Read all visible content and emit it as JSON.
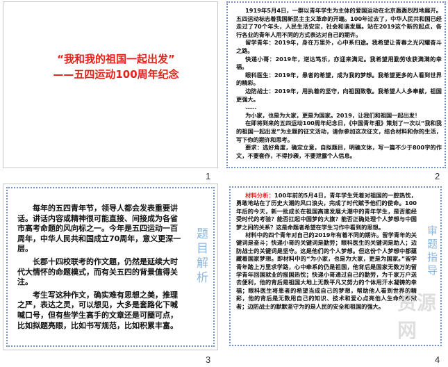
{
  "slides": [
    {
      "number": "1",
      "title_line1": "“我和我的祖国一起出发”",
      "title_line2": "——五四运动100周年纪念"
    },
    {
      "number": "2",
      "paragraphs": [
        "1919年5月4日，一群以青年学生为主体的爱国运动在北京轰轰烈烈地展开。五四运动标志着我国新民主主义革命的开端。100年过去了，中华人民共和国已经走过了70个年头，人民生活安定，社会和谐发展。站在2019这个新的起点，各行各业的青年人用不同的方式表达对自己的期许。",
        "留学青年：2019年，身在万里外，心中系归途。我希望让青春之光闪耀奋斗之路。",
        "快递小哥：2019年，逆达笃乐，亦迎来满足。我希望用勤劳收获满满的幸福。",
        "眼科医生：2019年，患者的希望，成为我的梦想。我希望更多的人看到世界的精彩。",
        "边防战士：2019年，用执着的坚守，向祖国致敬。我希望人人多奉献，祖国更强大。",
        "……",
        "为小家，也是为大家，更是为国家。2019，让我们和祖国一起出发！",
        "在即将到来的五四运动100周年纪念日，《中国青年报》策划了一次以“我和我的祖国一起出发”为主题的征文活动，请你参加这次征文，结合材料和你的生活，写下你的期许和思考。",
        "要求：选好角度，确定立意，自拟题目，明确文体，写一篇不少于800字的作文，不要套作，不得抄袭，不要泄露个人信息。"
      ]
    },
    {
      "number": "3",
      "paragraphs": [
        "每年的五四青年节，领导人都会发表重要讲话。讲话内容或精神很可能直接、间接成为各省市高考命题的风向标之一。今年是五四运动一百周年，中华人民共和国成立70周年，意义更深一层。",
        "长郡十四校联考的作文题，仍然是延续大时代大情怀的命题模式，而有关五四的背景值得关注。",
        "考生写这种作文，确实难有思想之美，推理之严，表达之灵，可以想见，大多是套路化下喊喊口号，但有些学生高手的文章还是可圈可点，比如拟题亮眼，比如书写规范，比如积累丰富。"
      ],
      "side_label": "题目解析"
    },
    {
      "number": "4",
      "lead": "材料分析",
      "paragraphs": [
        "100年前的5月4日，青年学生凭着对祖国的一腔热忱，勇敢地站在了历史大潮的风口浪尖，完成了时代赋予他们的使命。100年后的今天，新一批成长在祖国高速发展大潮中的青年学生，是否能经受时代的考验？能否扛起中国梦的大旗？能否正确处理个人梦想与中国梦之间的关系？这是命题者希望在学生习作中看到的思想。",
        "材料中的四个青年对自己的2019年有着不同的期许。留学青年的关键词是奋斗；快递小哥的关键词是勤劳；眼科医生的关键词是助人；边防战士的关键词是坚守。这是他们的个人梦想。但这份个人梦想中都蕴藏着国家梦想。即材料中的“为小家，也是为大家，更是为国家。”留学青年踏上万里求学路，心中牵系的仍是祖国，他背后是国家无数万的留学青年回国就业的报国热忱；快递小哥通过自己的勤劳，为千家万户送去便利，他的背后是祖国大地上无数平凡又努力的个体用汗水凝铸的幸福；眼科医生将患者的希望当成自己的梦想，帮助他人看到世界的精彩，他的背后是无数用自己的知识、技术和爱心点亮他人生命的奉献者；边防战士的默默坚守为的是人民的安全和祖国的强大。"
      ],
      "side_label": "审题指导"
    }
  ],
  "watermark": "资源网"
}
